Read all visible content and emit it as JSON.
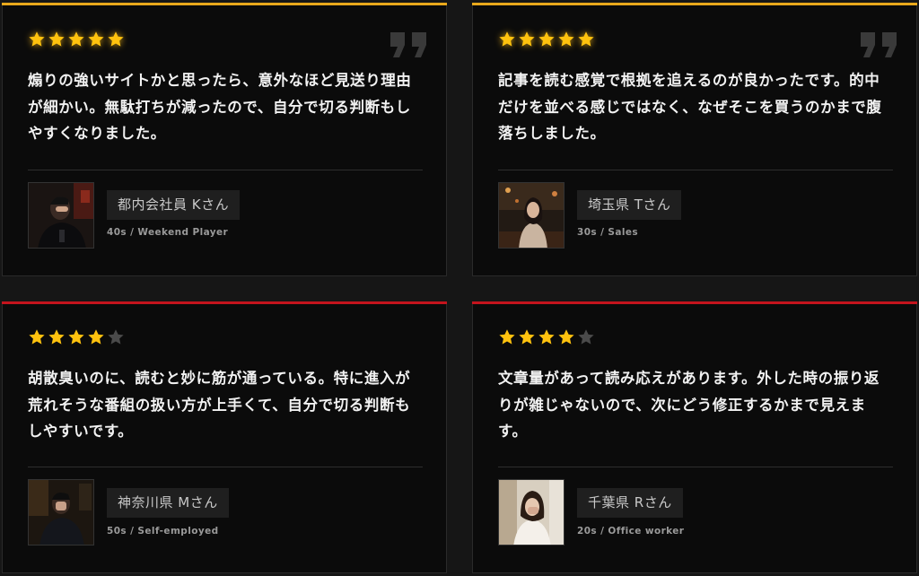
{
  "colors": {
    "gold_accent": "#e9a91c",
    "red_accent": "#c4141d",
    "star_on": "#ffc20e",
    "star_off": "#4a4a4a",
    "card_bg": "#0b0b0b"
  },
  "testimonials": [
    {
      "rating": 5,
      "max_rating": 5,
      "accent": "gold",
      "show_quote_icon": true,
      "text": "煽りの強いサイトかと思ったら、意外なほど見送り理由が細かい。無駄打ちが減ったので、自分で切る判断もしやすくなりました。",
      "name": "都内会社員 Kさん",
      "meta": "40s / Weekend Player",
      "avatar_icon": "person-photo-icon"
    },
    {
      "rating": 5,
      "max_rating": 5,
      "accent": "gold",
      "show_quote_icon": true,
      "text": "記事を読む感覚で根拠を追えるのが良かったです。的中だけを並べる感じではなく、なぜそこを買うのかまで腹落ちしました。",
      "name": "埼玉県 Tさん",
      "meta": "30s / Sales",
      "avatar_icon": "person-photo-icon"
    },
    {
      "rating": 4,
      "max_rating": 5,
      "accent": "red",
      "show_quote_icon": false,
      "text": "胡散臭いのに、読むと妙に筋が通っている。特に進入が荒れそうな番組の扱い方が上手くて、自分で切る判断もしやすいです。",
      "name": "神奈川県 Mさん",
      "meta": "50s / Self-employed",
      "avatar_icon": "person-photo-icon"
    },
    {
      "rating": 4,
      "max_rating": 5,
      "accent": "red",
      "show_quote_icon": false,
      "text": "文章量があって読み応えがあります。外した時の振り返りが雑じゃないので、次にどう修正するかまで見えます。",
      "name": "千葉県 Rさん",
      "meta": "20s / Office worker",
      "avatar_icon": "person-photo-icon"
    }
  ]
}
